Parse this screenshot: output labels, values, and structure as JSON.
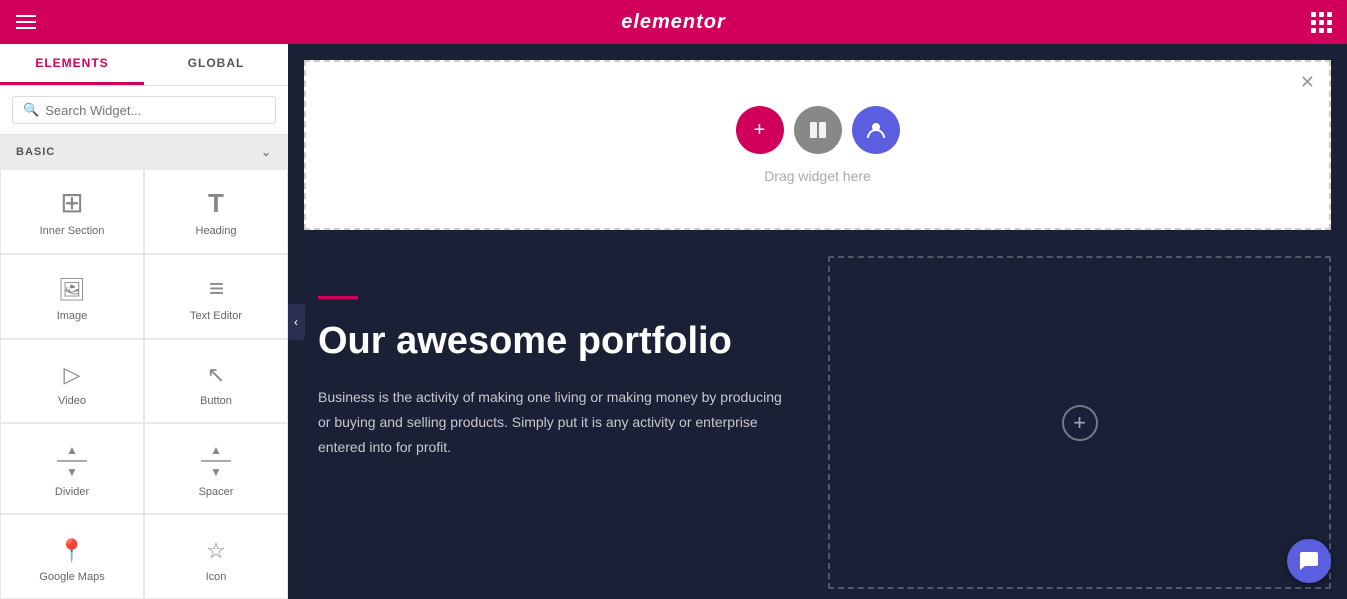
{
  "topbar": {
    "logo": "elementor",
    "hamburger_label": "menu",
    "grid_label": "apps"
  },
  "sidebar": {
    "tabs": [
      {
        "id": "elements",
        "label": "ELEMENTS",
        "active": true
      },
      {
        "id": "global",
        "label": "GLOBAL",
        "active": false
      }
    ],
    "search": {
      "placeholder": "Search Widget..."
    },
    "section_label": "BASIC",
    "widgets": [
      {
        "id": "inner-section",
        "label": "Inner Section",
        "icon": "inner-section"
      },
      {
        "id": "heading",
        "label": "Heading",
        "icon": "heading"
      },
      {
        "id": "image",
        "label": "Image",
        "icon": "image"
      },
      {
        "id": "text-editor",
        "label": "Text Editor",
        "icon": "text-editor"
      },
      {
        "id": "video",
        "label": "Video",
        "icon": "video"
      },
      {
        "id": "button",
        "label": "Button",
        "icon": "button"
      },
      {
        "id": "divider",
        "label": "Divider",
        "icon": "divider"
      },
      {
        "id": "spacer",
        "label": "Spacer",
        "icon": "spacer"
      },
      {
        "id": "map",
        "label": "Google Maps",
        "icon": "map"
      },
      {
        "id": "icon",
        "label": "Icon",
        "icon": "star"
      }
    ]
  },
  "canvas": {
    "drop_area": {
      "text": "Drag widget here",
      "btn_add": "+",
      "btn_layout": "□",
      "btn_user": "👤"
    },
    "content": {
      "heading": "Our awesome portfolio",
      "body": "Business is the activity of making one living or making money by producing or buying and selling products. Simply put it is any activity or enterprise entered into for profit."
    }
  },
  "colors": {
    "primary": "#d1005a",
    "sidebar_bg": "#f5f5f5",
    "canvas_bg": "#1a2035",
    "accent_purple": "#5b5fdf"
  }
}
